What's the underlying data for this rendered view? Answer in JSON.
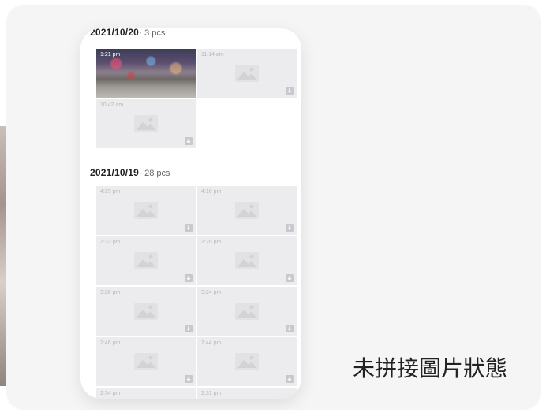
{
  "caption": "未拼接圖片狀態",
  "groups": [
    {
      "date": "2021/10/20",
      "separator": "·",
      "count": "3 pcs",
      "tiles": [
        {
          "time": "1:21 pm",
          "has_preview": true
        },
        {
          "time": "11:14 am",
          "has_preview": false
        },
        {
          "time": "10:42 am",
          "has_preview": false
        }
      ]
    },
    {
      "date": "2021/10/19",
      "separator": "·",
      "count": "28 pcs",
      "tiles": [
        {
          "time": "4:29 pm"
        },
        {
          "time": "4:16 pm"
        },
        {
          "time": "3:33 pm"
        },
        {
          "time": "3:20 pm"
        },
        {
          "time": "3:26 pm"
        },
        {
          "time": "3:24 pm"
        },
        {
          "time": "2:46 pm"
        },
        {
          "time": "2:44 pm"
        },
        {
          "time": "2:34 pm"
        },
        {
          "time": "2:31 pm"
        }
      ]
    }
  ],
  "colors": {
    "card_bg": "#f5f5f6",
    "tile_bg": "#ececee",
    "icon_gray": "#d4d4d8",
    "text": "#222222"
  },
  "icons": [
    "image-placeholder-icon",
    "download-icon"
  ]
}
